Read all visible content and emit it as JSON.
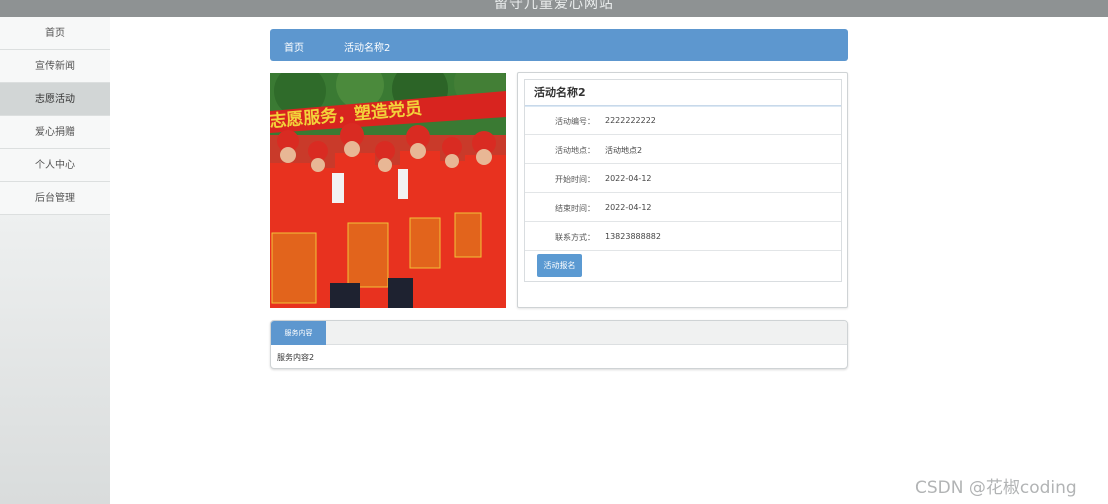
{
  "site": {
    "title": "留守儿童爱心网站"
  },
  "sidebar": {
    "items": [
      {
        "label": "首页"
      },
      {
        "label": "宣传新闻"
      },
      {
        "label": "志愿活动"
      },
      {
        "label": "爱心捐赠"
      },
      {
        "label": "个人中心"
      },
      {
        "label": "后台管理"
      }
    ]
  },
  "breadcrumb": {
    "home": "首页",
    "current": "活动名称2"
  },
  "photo": {
    "banner_text": "志愿服务，塑造党员"
  },
  "activity": {
    "title": "活动名称2",
    "fields": [
      {
        "label": "活动编号：",
        "value": "2222222222"
      },
      {
        "label": "活动地点：",
        "value": "活动地点2"
      },
      {
        "label": "开始时间：",
        "value": "2022-04-12"
      },
      {
        "label": "结束时间：",
        "value": "2022-04-12"
      },
      {
        "label": "联系方式：",
        "value": "13823888882"
      }
    ],
    "signup_label": "活动报名"
  },
  "content": {
    "tab_label": "服务内容",
    "text": "服务内容2"
  },
  "watermark": "CSDN @花椒coding",
  "colors": {
    "accent": "#5d97cf",
    "topbar": "#8e9293"
  }
}
